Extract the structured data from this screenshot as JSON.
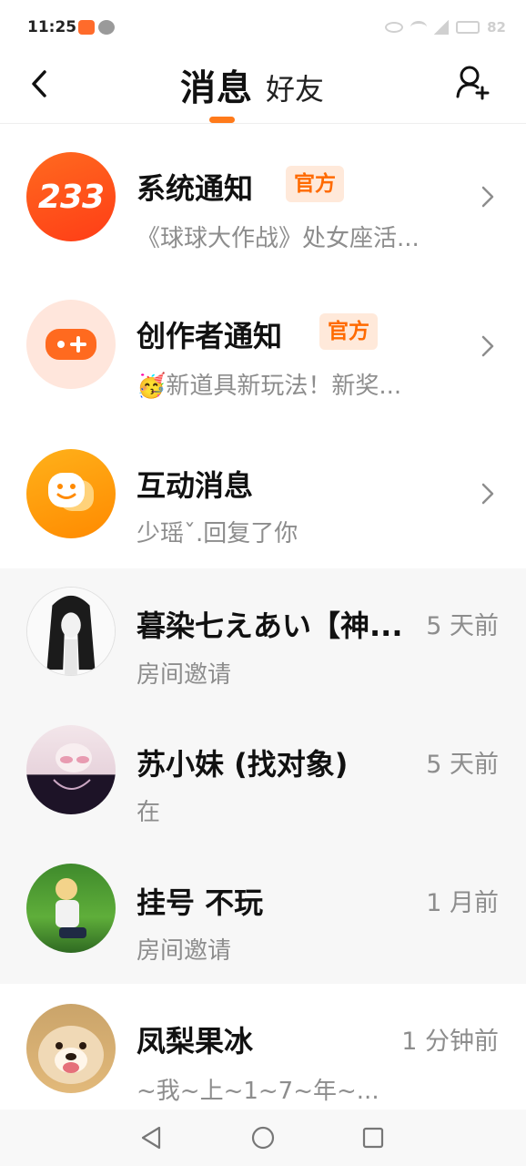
{
  "status_bar": {
    "time": "11:25",
    "battery": "82"
  },
  "header": {
    "tab_messages": "消息",
    "tab_friends": "好友"
  },
  "rows": [
    {
      "title": "系统通知",
      "badge": "官方",
      "subtitle": "《球球大作战》处女座活...",
      "avatar_text": "233"
    },
    {
      "title": "创作者通知",
      "badge": "官方",
      "subtitle": "🥳新道具新玩法！新奖..."
    },
    {
      "title": "互动消息",
      "subtitle": "少瑶ˇ.回复了你"
    },
    {
      "title": "暮染七えあい【神...",
      "time": "5 天前",
      "subtitle": "房间邀请"
    },
    {
      "title": "苏小妹 (找对象)",
      "time": "5 天前",
      "subtitle": "在"
    },
    {
      "title": "挂号 不玩",
      "time": "1 月前",
      "subtitle": "房间邀请"
    },
    {
      "title": "凤梨果冰",
      "time": "1 分钟前",
      "subtitle": "~我~上~1~7~年~..."
    }
  ],
  "colors": {
    "accent": "#ff7a1a",
    "badge_bg": "#ffe9da",
    "badge_text": "#ff6a00"
  }
}
